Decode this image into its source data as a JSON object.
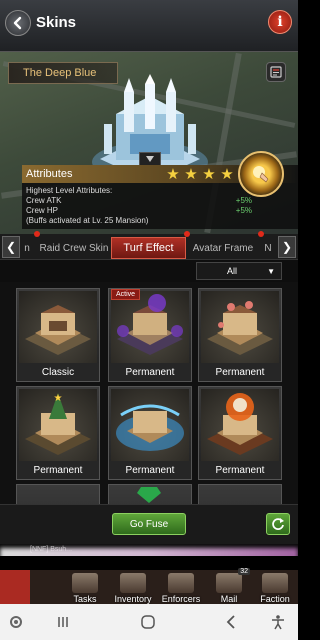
{
  "header": {
    "title": "Skins",
    "back_icon": "back-arrow-icon",
    "info_label": "i"
  },
  "preview": {
    "skin_name": "The Deep Blue"
  },
  "attributes": {
    "title": "Attributes",
    "stars": 4,
    "highest_label": "Highest Level Attributes:",
    "rows": [
      {
        "name": "Crew ATK",
        "value": "+5%"
      },
      {
        "name": "Crew HP",
        "value": "+5%"
      }
    ],
    "note": "(Buffs activated at Lv. 25 Mansion)"
  },
  "tabs": {
    "items": [
      {
        "label": "n",
        "active": false
      },
      {
        "label": "Raid Crew Skin",
        "active": false
      },
      {
        "label": "Turf Effect",
        "active": true
      },
      {
        "label": "Avatar Frame",
        "active": false
      },
      {
        "label": "N",
        "active": false
      }
    ]
  },
  "filter": {
    "selected": "All"
  },
  "cards": [
    {
      "label": "Classic",
      "active": false
    },
    {
      "label": "Permanent",
      "active": true,
      "tag": "Active"
    },
    {
      "label": "Permanent",
      "active": false
    },
    {
      "label": "Permanent",
      "active": false
    },
    {
      "label": "Permanent",
      "active": false
    },
    {
      "label": "Permanent",
      "active": false
    }
  ],
  "footer": {
    "go_fuse": "Go Fuse"
  },
  "chat": {
    "text": "[NNF] Bsuh..."
  },
  "bottom_nav": [
    {
      "label": "Tasks"
    },
    {
      "label": "Inventory"
    },
    {
      "label": "Enforcers"
    },
    {
      "label": "Mail",
      "badge": "32"
    },
    {
      "label": "Faction"
    }
  ],
  "colors": {
    "accent": "#b03025",
    "go_button": "#4a8a2c",
    "gold": "#e8c27a"
  }
}
